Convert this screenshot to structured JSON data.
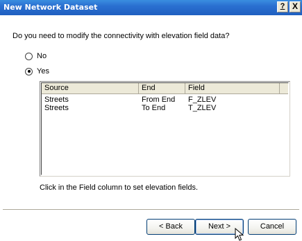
{
  "window": {
    "title": "New Network Dataset",
    "help_label": "?",
    "close_label": "X"
  },
  "question": "Do you need to modify the connectivity with elevation field data?",
  "options": {
    "no_label": "No",
    "yes_label": "Yes",
    "selected": "Yes"
  },
  "table": {
    "columns": [
      "Source",
      "End",
      "Field"
    ],
    "rows": [
      {
        "source": "Streets",
        "end": "From End",
        "field": "F_ZLEV"
      },
      {
        "source": "Streets",
        "end": "To End",
        "field": "T_ZLEV"
      }
    ]
  },
  "hint": "Click in the Field column to set elevation fields.",
  "buttons": {
    "back": "< Back",
    "next": "Next >",
    "cancel": "Cancel"
  },
  "colors": {
    "titlebar": "#2a6fd0",
    "dialog_bg": "#ece9d8",
    "button_border": "#003c74"
  },
  "icons": [
    "radio-icon",
    "mouse-cursor-icon"
  ]
}
